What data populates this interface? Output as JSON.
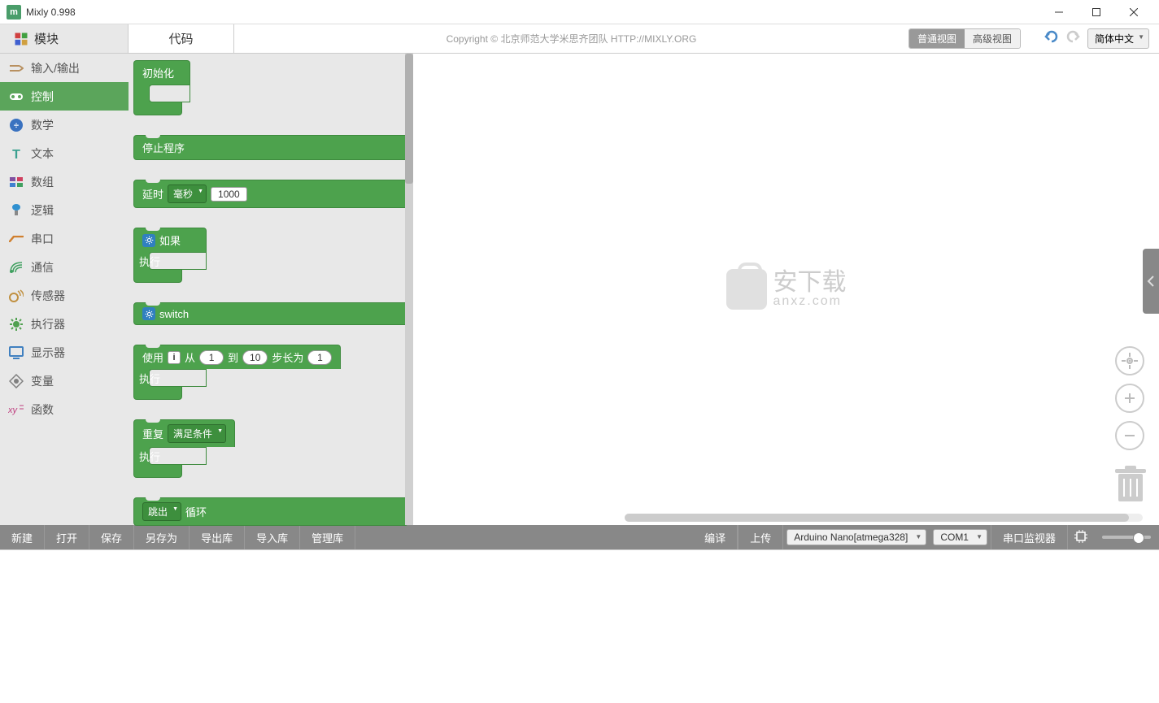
{
  "titlebar": {
    "title": "Mixly 0.998"
  },
  "tabs": {
    "blocks": "模块",
    "code": "代码"
  },
  "copyright": "Copyright  ©  北京师范大学米思齐团队 HTTP://MIXLY.ORG",
  "view": {
    "normal": "普通视图",
    "advanced": "高级视图"
  },
  "lang": "简体中文",
  "categories": [
    {
      "id": "io",
      "label": "输入/输出",
      "color": "#b89060"
    },
    {
      "id": "control",
      "label": "控制",
      "color": "#5ba55b",
      "active": true
    },
    {
      "id": "math",
      "label": "数学",
      "color": "#3a72c0"
    },
    {
      "id": "text",
      "label": "文本",
      "color": "#3aa090"
    },
    {
      "id": "array",
      "label": "数组",
      "color": "#8050a0"
    },
    {
      "id": "logic",
      "label": "逻辑",
      "color": "#3090d0"
    },
    {
      "id": "serial",
      "label": "串口",
      "color": "#d08030"
    },
    {
      "id": "comm",
      "label": "通信",
      "color": "#40a060"
    },
    {
      "id": "sensor",
      "label": "传感器",
      "color": "#c09040"
    },
    {
      "id": "actuator",
      "label": "执行器",
      "color": "#50a050"
    },
    {
      "id": "display",
      "label": "显示器",
      "color": "#4080c0"
    },
    {
      "id": "variable",
      "label": "变量",
      "color": "#808080"
    },
    {
      "id": "function",
      "label": "函数",
      "color": "#c04080"
    }
  ],
  "blocks": {
    "init": "初始化",
    "stop": "停止程序",
    "delay": "延时",
    "delay_unit": "毫秒",
    "delay_val": "1000",
    "if": "如果",
    "do": "执行",
    "switch": "switch",
    "for_use": "使用",
    "for_var": "i",
    "for_from": "从",
    "for_from_v": "1",
    "for_to": "到",
    "for_to_v": "10",
    "for_step": "步长为",
    "for_step_v": "1",
    "repeat": "重复",
    "repeat_cond": "满足条件",
    "break": "跳出",
    "loop": "循环"
  },
  "watermark": {
    "cn": "安下载",
    "en": "anxz.com"
  },
  "bottom": {
    "new": "新建",
    "open": "打开",
    "save": "保存",
    "saveas": "另存为",
    "exportlib": "导出库",
    "importlib": "导入库",
    "managelib": "管理库",
    "compile": "编译",
    "upload": "上传",
    "board": "Arduino Nano[atmega328]",
    "port": "COM1",
    "monitor": "串口监视器"
  }
}
